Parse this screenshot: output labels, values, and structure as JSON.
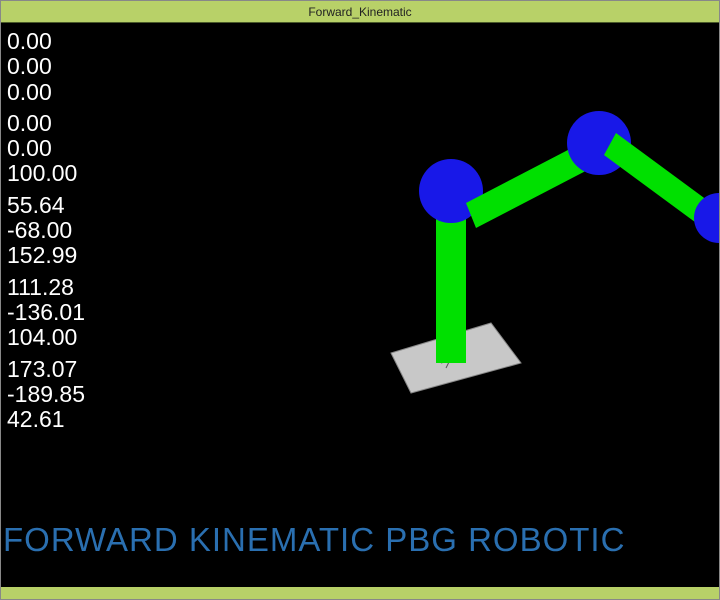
{
  "window": {
    "title": "Forward_Kinematic"
  },
  "readout": {
    "group0": {
      "a": "0.00",
      "b": "0.00",
      "c": "0.00"
    },
    "group1": {
      "a": "0.00",
      "b": "0.00",
      "c": "100.00"
    },
    "group2": {
      "a": "55.64",
      "b": "-68.00",
      "c": "152.99"
    },
    "group3": {
      "a": "111.28",
      "b": "-136.01",
      "c": "104.00"
    },
    "group4": {
      "a": "173.07",
      "b": "-189.85",
      "c": "42.61"
    }
  },
  "footer": {
    "title": "FORWARD KINEMATIC PBG ROBOTIC"
  },
  "colors": {
    "accent_bar": "#b8d168",
    "joint": "#1818e8",
    "link": "#00e000",
    "base_plate": "#c0c0c0",
    "title_fg": "#2a6fb0"
  },
  "chart_data": {
    "type": "diagram",
    "description": "3D forward-kinematic robot arm render",
    "joints_xyz": [
      {
        "x": 0.0,
        "y": 0.0,
        "z": 0.0
      },
      {
        "x": 0.0,
        "y": 0.0,
        "z": 100.0
      },
      {
        "x": 55.64,
        "y": -68.0,
        "z": 152.99
      },
      {
        "x": 111.28,
        "y": -136.01,
        "z": 104.0
      },
      {
        "x": 173.07,
        "y": -189.85,
        "z": 42.61
      }
    ]
  }
}
